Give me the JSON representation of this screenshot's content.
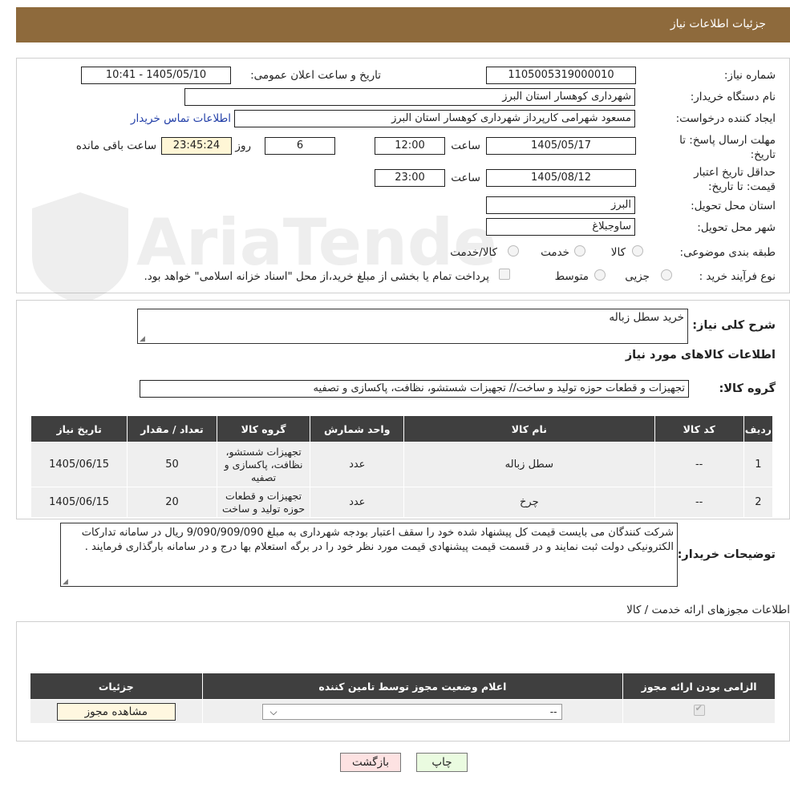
{
  "header": {
    "title": "جزئیات اطلاعات نیاز"
  },
  "form": {
    "need_number_label": "شماره نیاز:",
    "need_number": "1105005319000010",
    "announce_label": "تاریخ و ساعت اعلان عمومی:",
    "announce_value": "1405/05/10 - 10:41",
    "buyer_org_label": "نام دستگاه خریدار:",
    "buyer_org": "شهرداری کوهسار استان البرز",
    "creator_label": "ایجاد کننده درخواست:",
    "creator": "مسعود  شهرامی  کارپرداز شهرداری کوهسار استان البرز",
    "contact_link": "اطلاعات تماس خریدار",
    "deadline_label": "مهلت ارسال پاسخ: تا تاریخ:",
    "deadline_date": "1405/05/17",
    "time_label": "ساعت",
    "deadline_time": "12:00",
    "days": "6",
    "days_label": "روز و",
    "remaining_time": "23:45:24",
    "remaining_label": "ساعت باقی مانده",
    "validity_label": "حداقل تاریخ اعتبار قیمت: تا تاریخ:",
    "validity_date": "1405/08/12",
    "validity_time": "23:00",
    "province_label": "استان محل تحویل:",
    "province": "البرز",
    "city_label": "شهر محل تحویل:",
    "city": "ساوجبلاغ",
    "category_label": "طبقه بندی موضوعی:",
    "category_options": [
      "کالا",
      "خدمت",
      "کالا/خدمت"
    ],
    "process_label": "نوع فرآیند خرید :",
    "process_options": [
      "جزیی",
      "متوسط"
    ],
    "payment_note": "پرداخت تمام یا بخشی از مبلغ خرید،از محل \"اسناد خزانه اسلامی\" خواهد بود."
  },
  "summary": {
    "desc_label": "شرح کلی نیاز:",
    "desc": "خرید سطل زباله",
    "goods_info_title": "اطلاعات کالاهای مورد نیاز",
    "group_label": "گروه کالا:",
    "group": "تجهیزات و قطعات حوزه تولید و ساخت// تجهیزات شستشو، نظافت، پاکسازی و تصفیه",
    "table_headers": [
      "ردیف",
      "کد کالا",
      "نام کالا",
      "واحد شمارش",
      "گروه کالا",
      "تعداد / مقدار",
      "تاریخ نیاز"
    ],
    "rows": [
      {
        "row": "1",
        "code": "--",
        "name": "سطل زباله",
        "unit": "عدد",
        "group": "تجهیزات شستشو، نظافت، پاکسازی و تصفیه",
        "qty": "50",
        "date": "1405/06/15"
      },
      {
        "row": "2",
        "code": "--",
        "name": "چرخ",
        "unit": "عدد",
        "group": "تجهیزات و قطعات حوزه تولید و ساخت",
        "qty": "20",
        "date": "1405/06/15"
      }
    ],
    "buyer_notes_label": "توضیحات خریدار:",
    "buyer_notes": "شرکت کنندگان می بایست قیمت کل پیشنهاد شده  خود را سقف اعتبار بودجه شهرداری به مبلغ 9/090/909/090 ریال در سامانه تدارکات الکترونیکی دولت ثبت نمایند و در قسمت قیمت  پیشنهادی قیمت مورد نظر خود را در برگه استعلام بها درج و در سامانه بارگذاری  فرمایند ."
  },
  "permits": {
    "title": "اطلاعات مجوزهای ارائه خدمت / کالا",
    "headers": [
      "الزامی بودن ارائه مجوز",
      "اعلام وضعیت مجوز توسط تامین کننده",
      "جزئیات"
    ],
    "select_value": "--",
    "view_button": "مشاهده مجوز"
  },
  "buttons": {
    "print": "چاپ",
    "back": "بازگشت"
  },
  "watermark": "AriaTender.neT"
}
